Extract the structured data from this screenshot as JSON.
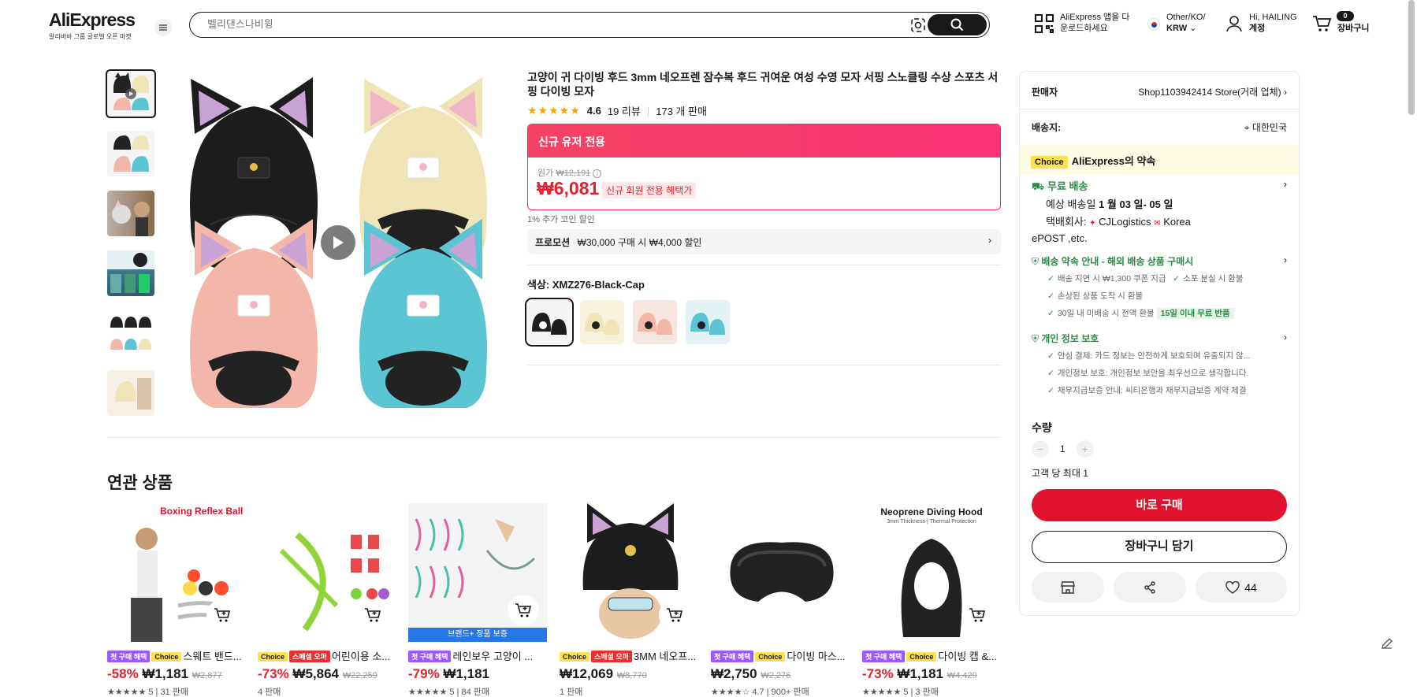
{
  "header": {
    "brand": "AliExpress",
    "tagline": "알리바바 그룹 글로벌 오픈 마켓",
    "search_placeholder": "벨리댄스나비윙",
    "app_promo_line1": "AliExpress 앱을 다",
    "app_promo_line2": "운로드하세요",
    "region_line1": "Other/KO/",
    "region_currency": "KRW",
    "greeting": "Hi, HAILING",
    "account": "계정",
    "cart_count": "0",
    "cart_label": "장바구니"
  },
  "product": {
    "title": "고양이 귀 다이빙 후드 3mm 네오프렌 잠수복 후드 귀여운 여성 수영 모자 서핑 스노클링 수상 스포츠 서핑 다이빙 모자",
    "rating": "4.6",
    "reviews": "19 리뷰",
    "sold": "173 개 판매",
    "promo_header": "신규 유저 전용",
    "original_label": "원가",
    "original_price": "₩12,191",
    "price": "₩6,081",
    "price_tag": "신규 회원 전용 혜택가",
    "coin_note": "1% 추가 코인 할인",
    "promotion_label": "프로모션",
    "promotion_text": "₩30,000 구매 시 ₩4,000 할인",
    "color_label": "색상: XMZ276-Black-Cap",
    "colors": [
      "#1e1e1e",
      "#efe4b5",
      "#f2b7a8",
      "#5cc5d4"
    ]
  },
  "related": {
    "title": "연관 상품",
    "items": [
      {
        "badges": [
          "첫 구매 혜택",
          "Choice"
        ],
        "name": "스웨트 밴드...",
        "disc": "-58%",
        "price": "₩1,181",
        "orig": "₩2,877",
        "meta": "★★★★★ 5 | 31 판매",
        "img_text": "Boxing Reflex Ball"
      },
      {
        "badges": [
          "Choice",
          "스페셜 오퍼"
        ],
        "name": "어린이용 소...",
        "disc": "-73%",
        "price": "₩5,864",
        "orig": "₩22,259",
        "meta": "4 판매",
        "img_text": ""
      },
      {
        "badges": [
          "첫 구매 혜택"
        ],
        "name": "레인보우 고양이 ...",
        "disc": "-79%",
        "price": "₩1,181",
        "orig": "",
        "meta": "★★★★★ 5 | 84 판매",
        "img_text": "브랜드+ 정품 보증"
      },
      {
        "badges": [
          "Choice",
          "스페셜 오퍼"
        ],
        "name": "3MM 네오프...",
        "disc": "",
        "price": "₩12,069",
        "orig": "₩8,770",
        "meta": "1 판매",
        "img_text": ""
      },
      {
        "badges": [
          "첫 구매 혜택",
          "Choice"
        ],
        "name": "다이빙 마스...",
        "disc": "",
        "price": "₩2,750",
        "orig": "₩2,276",
        "meta": "★★★★☆ 4.7 | 900+ 판매",
        "img_text": ""
      },
      {
        "badges": [
          "첫 구매 혜택",
          "Choice"
        ],
        "name": "다이빙 캡 &...",
        "disc": "-73%",
        "price": "₩1,181",
        "orig": "₩4,429",
        "meta": "★★★★★ 5 | 3 판매",
        "img_text": "Neoprene Diving Hood"
      }
    ],
    "hood_subtitle": "3mm Thickness | Thermal Protection"
  },
  "panel": {
    "seller_label": "판매자",
    "seller_name": "Shop1103942414 Store(거래 업체)",
    "ship_to_label": "배송지:",
    "ship_to": "대한민국",
    "choice_tag": "Choice",
    "choice_title": "AliExpress의 약속",
    "free_shipping": "무료 배송",
    "est_delivery_label": "예상 배송일",
    "est_delivery": "1 월 03 일- 05 일",
    "carrier_label": "택배회사:",
    "carrier1": "CJLogistics",
    "carrier2": "Korea",
    "carrier3": "ePOST ,etc.",
    "guarantee_title": "배송 약속 안내 - 해외 배송 상품 구매시",
    "guarantee_items": [
      "배송 지연 시 ₩1,300 쿠폰 지급",
      "소포 분실 시 환불",
      "손상된 상품 도착 시 환불",
      "30일 내 미배송 시 전액 환불"
    ],
    "return_tag": "15일 이내 무료 반품",
    "privacy_title": "개인 정보 보호",
    "privacy_items": [
      "안심 결제: 카드 정보는 안전하게 보호되며 유출되지 않...",
      "개인정보 보호: 개인정보 보안을 최우선으로 생각합니다.",
      "채무지급보증 안내: 씨티은행과 채무지급보증 계약 체결"
    ],
    "qty_label": "수량",
    "qty_value": "1",
    "qty_limit": "고객 당 최대 1",
    "buy_now": "바로 구매",
    "add_cart": "장바구니 담기",
    "wishlist_count": "44"
  },
  "colors": {
    "accent_red": "#e0122e",
    "price_red": "#e6212b",
    "green": "#2a8a43",
    "choice_yellow": "#ffe14d"
  }
}
